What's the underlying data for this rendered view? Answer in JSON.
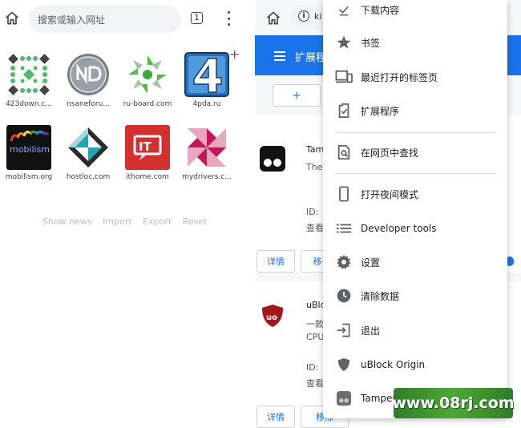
{
  "left": {
    "search_placeholder": "搜索或输入网址",
    "tab_count": "1",
    "tiles": [
      {
        "label": "423down.c..."
      },
      {
        "label": "nsaneforu..."
      },
      {
        "label": "ru-board.com"
      },
      {
        "label": "4pda.ru"
      },
      {
        "label": "mobilism.org"
      },
      {
        "label": "hostloc.com"
      },
      {
        "label": "ithome.com"
      },
      {
        "label": "mydrivers.c..."
      }
    ],
    "footer": {
      "show_news": "Show news",
      "import": "Import",
      "export": "Export",
      "reset": "Reset"
    }
  },
  "right": {
    "url_text": "ki",
    "header_title": "扩展程",
    "add_label": "+",
    "ext1": {
      "name": "Tam",
      "desc": "The",
      "id_label": "ID:",
      "view_label": "查看"
    },
    "ext2": {
      "name": "uBlo",
      "desc": "一款",
      "cpu": "CPU",
      "id_label": "ID:",
      "view_label": "查看"
    },
    "details_label": "详情",
    "remove_label": "移除",
    "remove_short": "移"
  },
  "menu": {
    "items": [
      {
        "label": "下载内容"
      },
      {
        "label": "书签"
      },
      {
        "label": "最近打开的标签页"
      },
      {
        "label": "扩展程序"
      },
      {
        "label": "在网页中查找"
      },
      {
        "label": "打开夜间模式"
      },
      {
        "label": "Developer tools"
      },
      {
        "label": "设置"
      },
      {
        "label": "清除数据"
      },
      {
        "label": "退出"
      },
      {
        "label": "uBlock Origin"
      },
      {
        "label": "Tamperm"
      }
    ]
  },
  "watermark": "www.08rj.com"
}
